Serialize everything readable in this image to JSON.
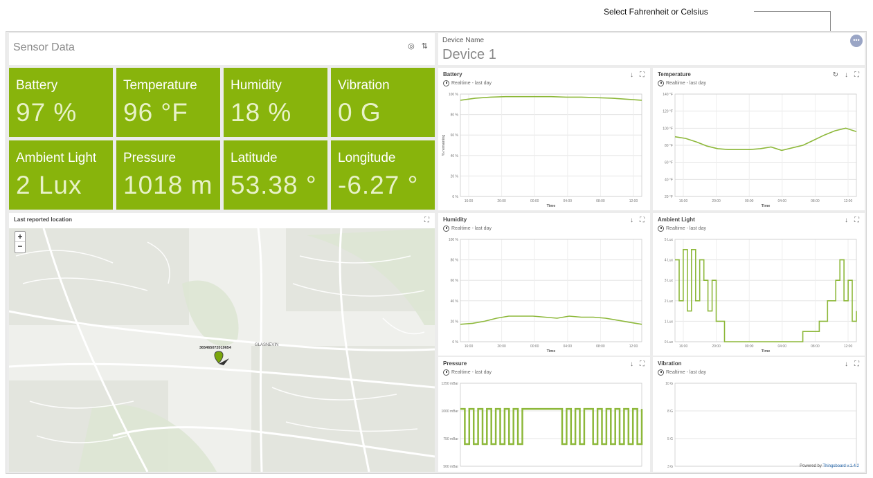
{
  "callout": {
    "text": "Select Fahrenheit or Celsius"
  },
  "header": {
    "title": "Sensor Data",
    "device_label": "Device Name",
    "device_value": "Device 1"
  },
  "tiles": [
    {
      "label": "Battery",
      "value": "97 %"
    },
    {
      "label": "Temperature",
      "value": "96 °F"
    },
    {
      "label": "Humidity",
      "value": "18 %"
    },
    {
      "label": "Vibration",
      "value": "0 G"
    },
    {
      "label": "Ambient Light",
      "value": "2 Lux"
    },
    {
      "label": "Pressure",
      "value": "1018 m"
    },
    {
      "label": "Latitude",
      "value": "53.38 °"
    },
    {
      "label": "Longitude",
      "value": "-6.27 °"
    }
  ],
  "map": {
    "title": "Last reported location",
    "zoom_in": "+",
    "zoom_out": "−",
    "marker_label": "365465072019654",
    "place": "GLASNEVIN"
  },
  "footer": {
    "powered_prefix": "Powered by ",
    "powered_link": "Thingsboard v.1.4.2"
  },
  "colors": {
    "accent": "#88b40c",
    "line": "#8db83a"
  },
  "realtime": "Realtime - last day",
  "chart_data": [
    {
      "id": "battery",
      "type": "line",
      "title": "Battery",
      "subtitle": "Realtime - last day",
      "ylabel": "% remaining",
      "xlabel": "Time",
      "yticks": [
        "0 %",
        "20 %",
        "40 %",
        "60 %",
        "80 %",
        "100 %"
      ],
      "ylim": [
        0,
        100
      ],
      "xticks": [
        "16:00",
        "20:00",
        "00:00",
        "04:00",
        "08:00",
        "12:00"
      ],
      "series": [
        {
          "values": [
            94,
            96,
            97,
            97.5,
            97.5,
            97.5,
            97.5,
            97,
            97,
            96.5,
            96,
            95,
            94
          ]
        }
      ]
    },
    {
      "id": "temperature",
      "type": "line",
      "title": "Temperature",
      "subtitle": "Realtime - last day",
      "xlabel": "Time",
      "yticks": [
        "20 °F",
        "40 °F",
        "60 °F",
        "80 °F",
        "100 °F",
        "120 °F",
        "140 °F"
      ],
      "ylim": [
        20,
        140
      ],
      "xticks": [
        "16:00",
        "20:00",
        "00:00",
        "04:00",
        "08:00",
        "12:00"
      ],
      "series": [
        {
          "values": [
            90,
            88,
            84,
            79,
            76,
            75,
            75,
            75,
            76,
            78,
            74,
            77,
            80,
            86,
            92,
            97,
            100,
            96
          ]
        }
      ]
    },
    {
      "id": "humidity",
      "type": "line",
      "title": "Humidity",
      "subtitle": "Realtime - last day",
      "xlabel": "Time",
      "yticks": [
        "0 %",
        "20 %",
        "40 %",
        "60 %",
        "80 %",
        "100 %"
      ],
      "ylim": [
        0,
        100
      ],
      "xticks": [
        "16:00",
        "20:00",
        "00:00",
        "04:00",
        "08:00",
        "12:00"
      ],
      "series": [
        {
          "values": [
            17,
            18,
            20,
            23,
            25,
            25,
            25,
            24,
            23,
            25,
            24,
            24,
            23,
            21,
            19,
            17
          ]
        }
      ]
    },
    {
      "id": "ambient",
      "type": "line",
      "title": "Ambient Light",
      "subtitle": "Realtime - last day",
      "xlabel": "Time",
      "yticks": [
        "0 Lux",
        "1 Lux",
        "2 Lux",
        "3 Lux",
        "4 Lux",
        "5 Lux"
      ],
      "ylim": [
        0,
        5
      ],
      "xticks": [
        "16:00",
        "20:00",
        "00:00",
        "04:00",
        "08:00",
        "12:00"
      ],
      "series": [
        {
          "values": [
            4,
            2,
            4.5,
            1.5,
            4.5,
            2,
            4,
            3,
            1.5,
            3,
            1,
            1,
            0,
            0,
            0,
            0,
            0,
            0,
            0,
            0,
            0,
            0,
            0,
            0,
            0,
            0,
            0,
            0,
            0,
            0,
            0,
            0.5,
            0.5,
            0.5,
            0.5,
            1,
            1,
            2,
            2,
            3,
            4,
            2,
            3,
            1,
            1.5
          ]
        }
      ]
    },
    {
      "id": "pressure",
      "type": "line",
      "title": "Pressure",
      "subtitle": "Realtime - last day",
      "xlabel": "",
      "yticks": [
        "500 mBar",
        "750 mBar",
        "1000 mBar",
        "1250 mBar"
      ],
      "ylim": [
        500,
        1250
      ],
      "xticks": [],
      "series": [
        {
          "values": [
            1018,
            700,
            1018,
            700,
            1018,
            700,
            1018,
            700,
            1018,
            700,
            1018,
            700,
            1018,
            700,
            1018,
            1018,
            1018,
            1018,
            1018,
            1018,
            1018,
            1018,
            1018,
            700,
            1018,
            700,
            1018,
            700,
            1018,
            1018,
            700,
            1018,
            700,
            1018,
            700,
            1018,
            700,
            1018,
            700,
            1018,
            700,
            1018
          ]
        }
      ]
    },
    {
      "id": "vibration",
      "type": "line",
      "title": "Vibration",
      "subtitle": "Realtime - last day",
      "xlabel": "",
      "yticks": [
        "3 G",
        "5 G",
        "8 G",
        "10 G"
      ],
      "ylim": [
        2,
        11
      ],
      "xticks": [],
      "series": []
    }
  ]
}
